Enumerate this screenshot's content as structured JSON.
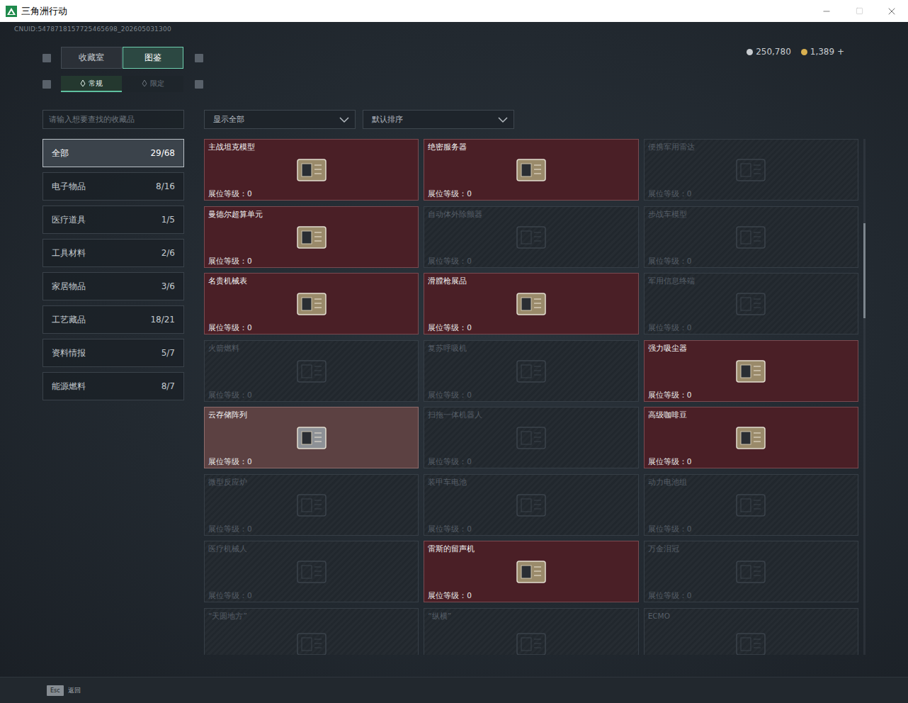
{
  "window": {
    "title": "三角洲行动"
  },
  "uid": "CNUID:5478718157725465698_202605031300",
  "currencies": [
    {
      "amount": "250,780",
      "color": "#c8ccd0"
    },
    {
      "amount": "1,389 +",
      "color": "#d8b050"
    }
  ],
  "top_tabs": [
    {
      "label": "收藏室",
      "selected": false
    },
    {
      "label": "图鉴",
      "selected": true
    }
  ],
  "sub_tabs": [
    {
      "label": "常规",
      "selected": true
    },
    {
      "label": "限定",
      "selected": false
    }
  ],
  "search": {
    "placeholder": "请输入想要查找的收藏品"
  },
  "filters": [
    {
      "label": "显示全部"
    },
    {
      "label": "默认排序"
    }
  ],
  "categories": [
    {
      "name": "全部",
      "count": "29/68",
      "selected": true
    },
    {
      "name": "电子物品",
      "count": "8/16",
      "selected": false
    },
    {
      "name": "医疗道具",
      "count": "1/5",
      "selected": false
    },
    {
      "name": "工具材料",
      "count": "2/6",
      "selected": false
    },
    {
      "name": "家居物品",
      "count": "3/6",
      "selected": false
    },
    {
      "name": "工艺藏品",
      "count": "18/21",
      "selected": false
    },
    {
      "name": "资料情报",
      "count": "5/7",
      "selected": false
    },
    {
      "name": "能源燃料",
      "count": "8/7",
      "selected": false
    }
  ],
  "items": [
    {
      "name": "主战坦克模型",
      "level": "展位等级：0",
      "owned": true,
      "highlighted": false
    },
    {
      "name": "绝密服务器",
      "level": "展位等级：0",
      "owned": true,
      "highlighted": false
    },
    {
      "name": "便携军用雷达",
      "level": "展位等级：0",
      "owned": false,
      "highlighted": false
    },
    {
      "name": "曼德尔超算单元",
      "level": "展位等级：0",
      "owned": true,
      "highlighted": false
    },
    {
      "name": "自动体外除颤器",
      "level": "展位等级：0",
      "owned": false,
      "highlighted": false
    },
    {
      "name": "步战车模型",
      "level": "展位等级：0",
      "owned": false,
      "highlighted": false
    },
    {
      "name": "名贵机械表",
      "level": "展位等级：0",
      "owned": true,
      "highlighted": false
    },
    {
      "name": "滑膛枪展品",
      "level": "展位等级：0",
      "owned": true,
      "highlighted": false
    },
    {
      "name": "军用信息终端",
      "level": "展位等级：0",
      "owned": false,
      "highlighted": false
    },
    {
      "name": "火箭燃料",
      "level": "展位等级：0",
      "owned": false,
      "highlighted": false
    },
    {
      "name": "复苏呼吸机",
      "level": "展位等级：0",
      "owned": false,
      "highlighted": false
    },
    {
      "name": "强力吸尘器",
      "level": "展位等级：0",
      "owned": true,
      "highlighted": false
    },
    {
      "name": "云存储阵列",
      "level": "展位等级：0",
      "owned": true,
      "highlighted": true
    },
    {
      "name": "扫拖一体机器人",
      "level": "展位等级：0",
      "owned": false,
      "highlighted": false
    },
    {
      "name": "高级咖啡豆",
      "level": "展位等级：0",
      "owned": true,
      "highlighted": false
    },
    {
      "name": "微型反应炉",
      "level": "展位等级：0",
      "owned": false,
      "highlighted": false
    },
    {
      "name": "装甲车电池",
      "level": "展位等级：0",
      "owned": false,
      "highlighted": false
    },
    {
      "name": "动力电池组",
      "level": "展位等级：0",
      "owned": false,
      "highlighted": false
    },
    {
      "name": "医疗机械人",
      "level": "展位等级：0",
      "owned": false,
      "highlighted": false
    },
    {
      "name": "雷斯的留声机",
      "level": "展位等级：0",
      "owned": true,
      "highlighted": false
    },
    {
      "name": "万金泪冠",
      "level": "展位等级：0",
      "owned": false,
      "highlighted": false
    },
    {
      "name": "“天圆地方”",
      "level": "",
      "owned": false,
      "highlighted": false
    },
    {
      "name": "“纵横”",
      "level": "",
      "owned": false,
      "highlighted": false
    },
    {
      "name": "ECMO",
      "level": "",
      "owned": false,
      "highlighted": false
    }
  ],
  "scrollbar": {
    "thumb_start": 0.163,
    "thumb_size": 0.185
  },
  "footer": {
    "key": "Esc",
    "label": "返回"
  }
}
